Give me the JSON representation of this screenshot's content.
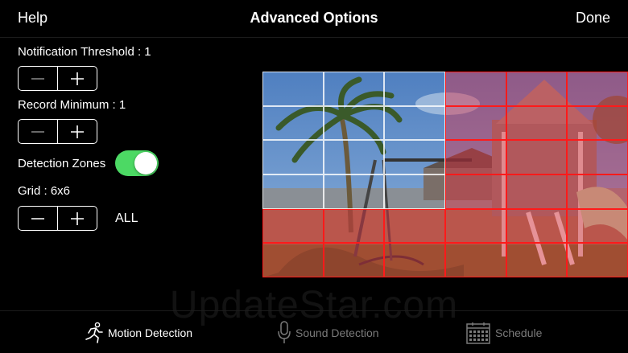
{
  "navbar": {
    "left_label": "Help",
    "title": "Advanced Options",
    "right_label": "Done"
  },
  "settings": {
    "notification_threshold": "Notification Threshold : 1",
    "record_minimum": "Record Minimum : 1",
    "detection_zones": {
      "label": "Detection Zones",
      "enabled": true
    },
    "grid": "Grid : 6x6",
    "all_label": "ALL"
  },
  "zone_grid": {
    "rows": 6,
    "cols": 6,
    "selected": [
      [
        false,
        false,
        false,
        true,
        true,
        true
      ],
      [
        false,
        false,
        false,
        true,
        true,
        true
      ],
      [
        false,
        false,
        false,
        true,
        true,
        true
      ],
      [
        false,
        false,
        false,
        true,
        true,
        true
      ],
      [
        true,
        true,
        true,
        true,
        true,
        true
      ],
      [
        true,
        true,
        true,
        true,
        true,
        true
      ]
    ]
  },
  "watermark": "UpdateStar.com",
  "tabs": [
    {
      "label": "Motion Detection",
      "icon": "running-person-icon",
      "active": true
    },
    {
      "label": "Sound Detection",
      "icon": "microphone-icon",
      "active": false
    },
    {
      "label": "Schedule",
      "icon": "calendar-icon",
      "active": false
    }
  ],
  "colors": {
    "toggle_on": "#4cd964",
    "zone_selected": "#ff1a1a"
  }
}
